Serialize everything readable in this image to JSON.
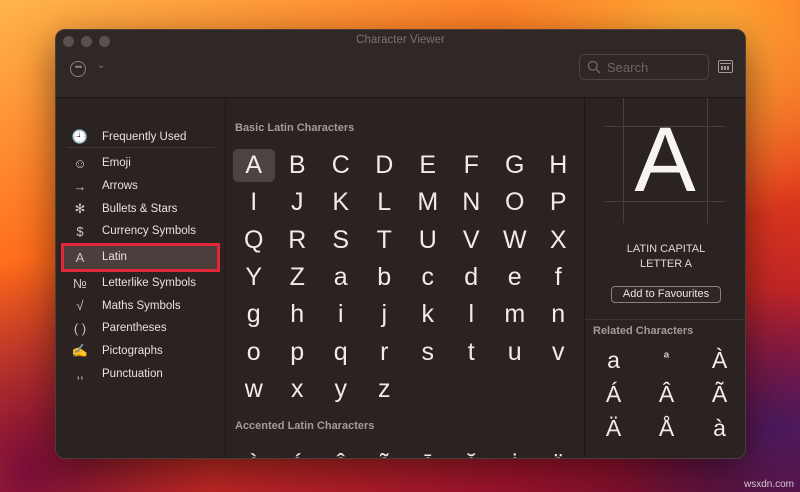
{
  "window": {
    "title": "Character Viewer"
  },
  "toolbar": {
    "search_placeholder": "Search"
  },
  "sidebar": {
    "top_items": [
      {
        "label": "Frequently Used",
        "icon": "clock-icon",
        "glyph": "🕘"
      }
    ],
    "items": [
      {
        "label": "Emoji",
        "icon": "smiley-icon",
        "glyph": "☺"
      },
      {
        "label": "Arrows",
        "icon": "arrow-icon",
        "glyph": "→"
      },
      {
        "label": "Bullets & Stars",
        "icon": "asterisk-icon",
        "glyph": "✻"
      },
      {
        "label": "Currency Symbols",
        "icon": "dollar-icon",
        "glyph": "$"
      },
      {
        "label": "Latin",
        "icon": "latin-a-icon",
        "glyph": "A",
        "selected": true
      },
      {
        "label": "Letterlike Symbols",
        "icon": "numero-icon",
        "glyph": "№"
      },
      {
        "label": "Maths Symbols",
        "icon": "square-root-icon",
        "glyph": "√"
      },
      {
        "label": "Parentheses",
        "icon": "parentheses-icon",
        "glyph": "( )"
      },
      {
        "label": "Pictographs",
        "icon": "pictograph-icon",
        "glyph": "✍"
      },
      {
        "label": "Punctuation",
        "icon": "punctuation-icon",
        "glyph": ",,"
      }
    ]
  },
  "grid": {
    "basic_title": "Basic Latin Characters",
    "basic_chars": [
      "A",
      "B",
      "C",
      "D",
      "E",
      "F",
      "G",
      "H",
      "I",
      "J",
      "K",
      "L",
      "M",
      "N",
      "O",
      "P",
      "Q",
      "R",
      "S",
      "T",
      "U",
      "V",
      "W",
      "X",
      "Y",
      "Z",
      "a",
      "b",
      "c",
      "d",
      "e",
      "f",
      "g",
      "h",
      "i",
      "j",
      "k",
      "l",
      "m",
      "n",
      "o",
      "p",
      "q",
      "r",
      "s",
      "t",
      "u",
      "v",
      "w",
      "x",
      "y",
      "z"
    ],
    "accented_title": "Accented Latin Characters",
    "accented_chars": [
      "À",
      "Á",
      "Â",
      "Ã",
      "Ā",
      "Ă",
      "Ȧ",
      "Ä"
    ]
  },
  "detail": {
    "glyph": "A",
    "name_line1": "LATIN CAPITAL",
    "name_line2": "LETTER A",
    "fav_label": "Add to Favourites",
    "related_title": "Related Characters",
    "related_chars": [
      "a",
      "ª",
      "À",
      "Á",
      "Â",
      "Ã",
      "Ä",
      "Å",
      "à"
    ]
  },
  "watermark": "wsxdn.com"
}
